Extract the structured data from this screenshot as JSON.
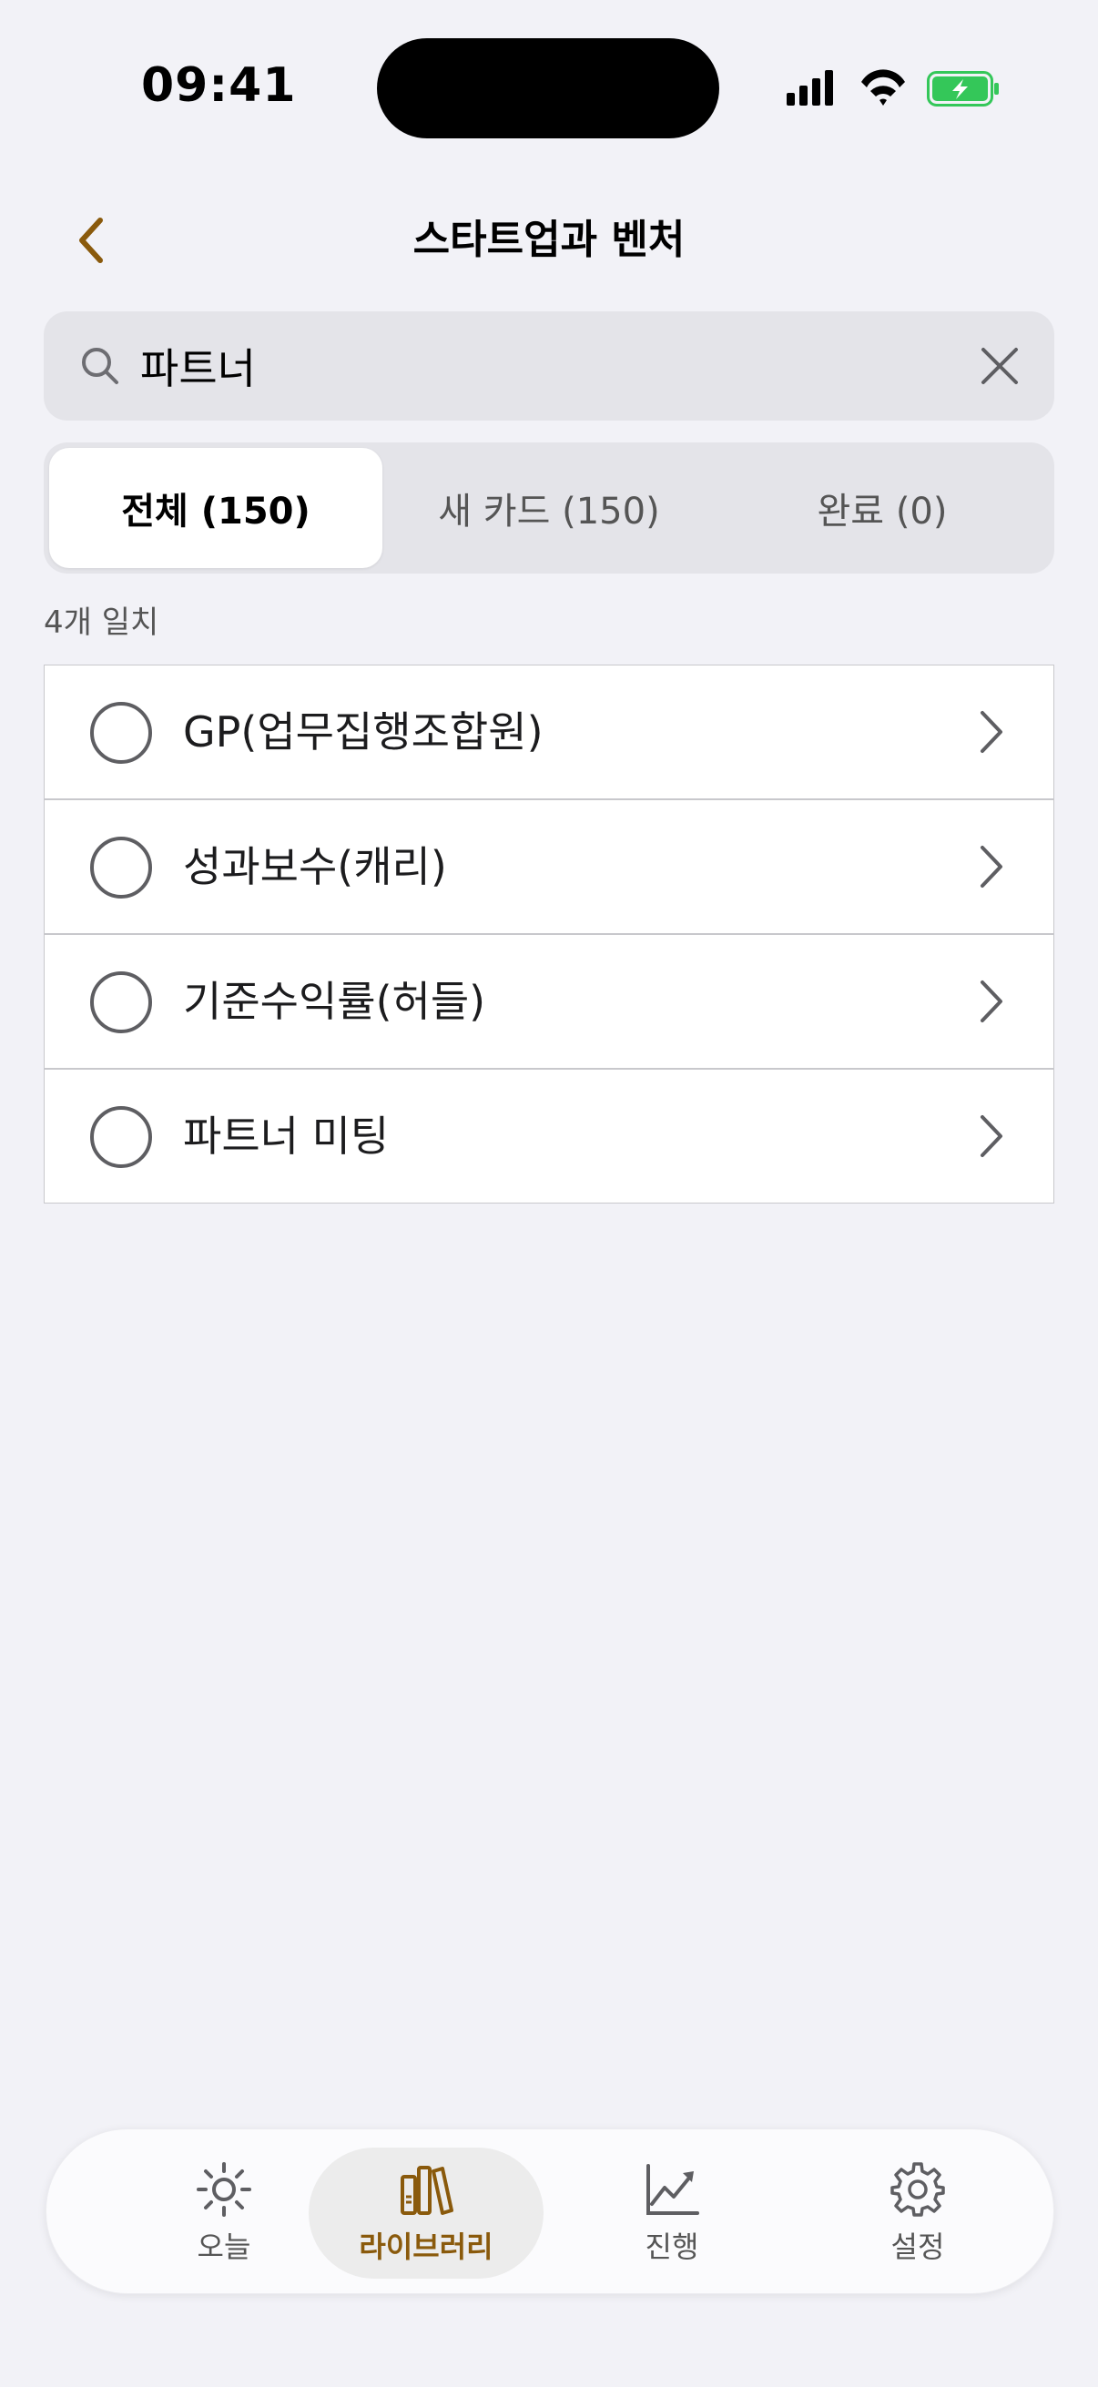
{
  "status_bar": {
    "time": "09:41"
  },
  "nav": {
    "title": "스타트업과 벤처"
  },
  "search": {
    "value": "파트너"
  },
  "segments": [
    {
      "label": "전체 (150)",
      "active": true
    },
    {
      "label": "새 카드 (150)",
      "active": false
    },
    {
      "label": "완료 (0)",
      "active": false
    }
  ],
  "match_count": "4개 일치",
  "items": [
    {
      "label": "GP(업무집행조합원)"
    },
    {
      "label": "성과보수(캐리)"
    },
    {
      "label": "기준수익률(허들)"
    },
    {
      "label": "파트너 미팅"
    }
  ],
  "tabbar": {
    "tabs": [
      {
        "label": "오늘",
        "icon": "sun-icon",
        "active": false
      },
      {
        "label": "라이브러리",
        "icon": "books-icon",
        "active": true
      },
      {
        "label": "진행",
        "icon": "chart-icon",
        "active": false
      },
      {
        "label": "설정",
        "icon": "gear-icon",
        "active": false
      }
    ]
  },
  "colors": {
    "accent": "#8a5a0c",
    "background": "#f2f2f7",
    "battery": "#34c759"
  }
}
